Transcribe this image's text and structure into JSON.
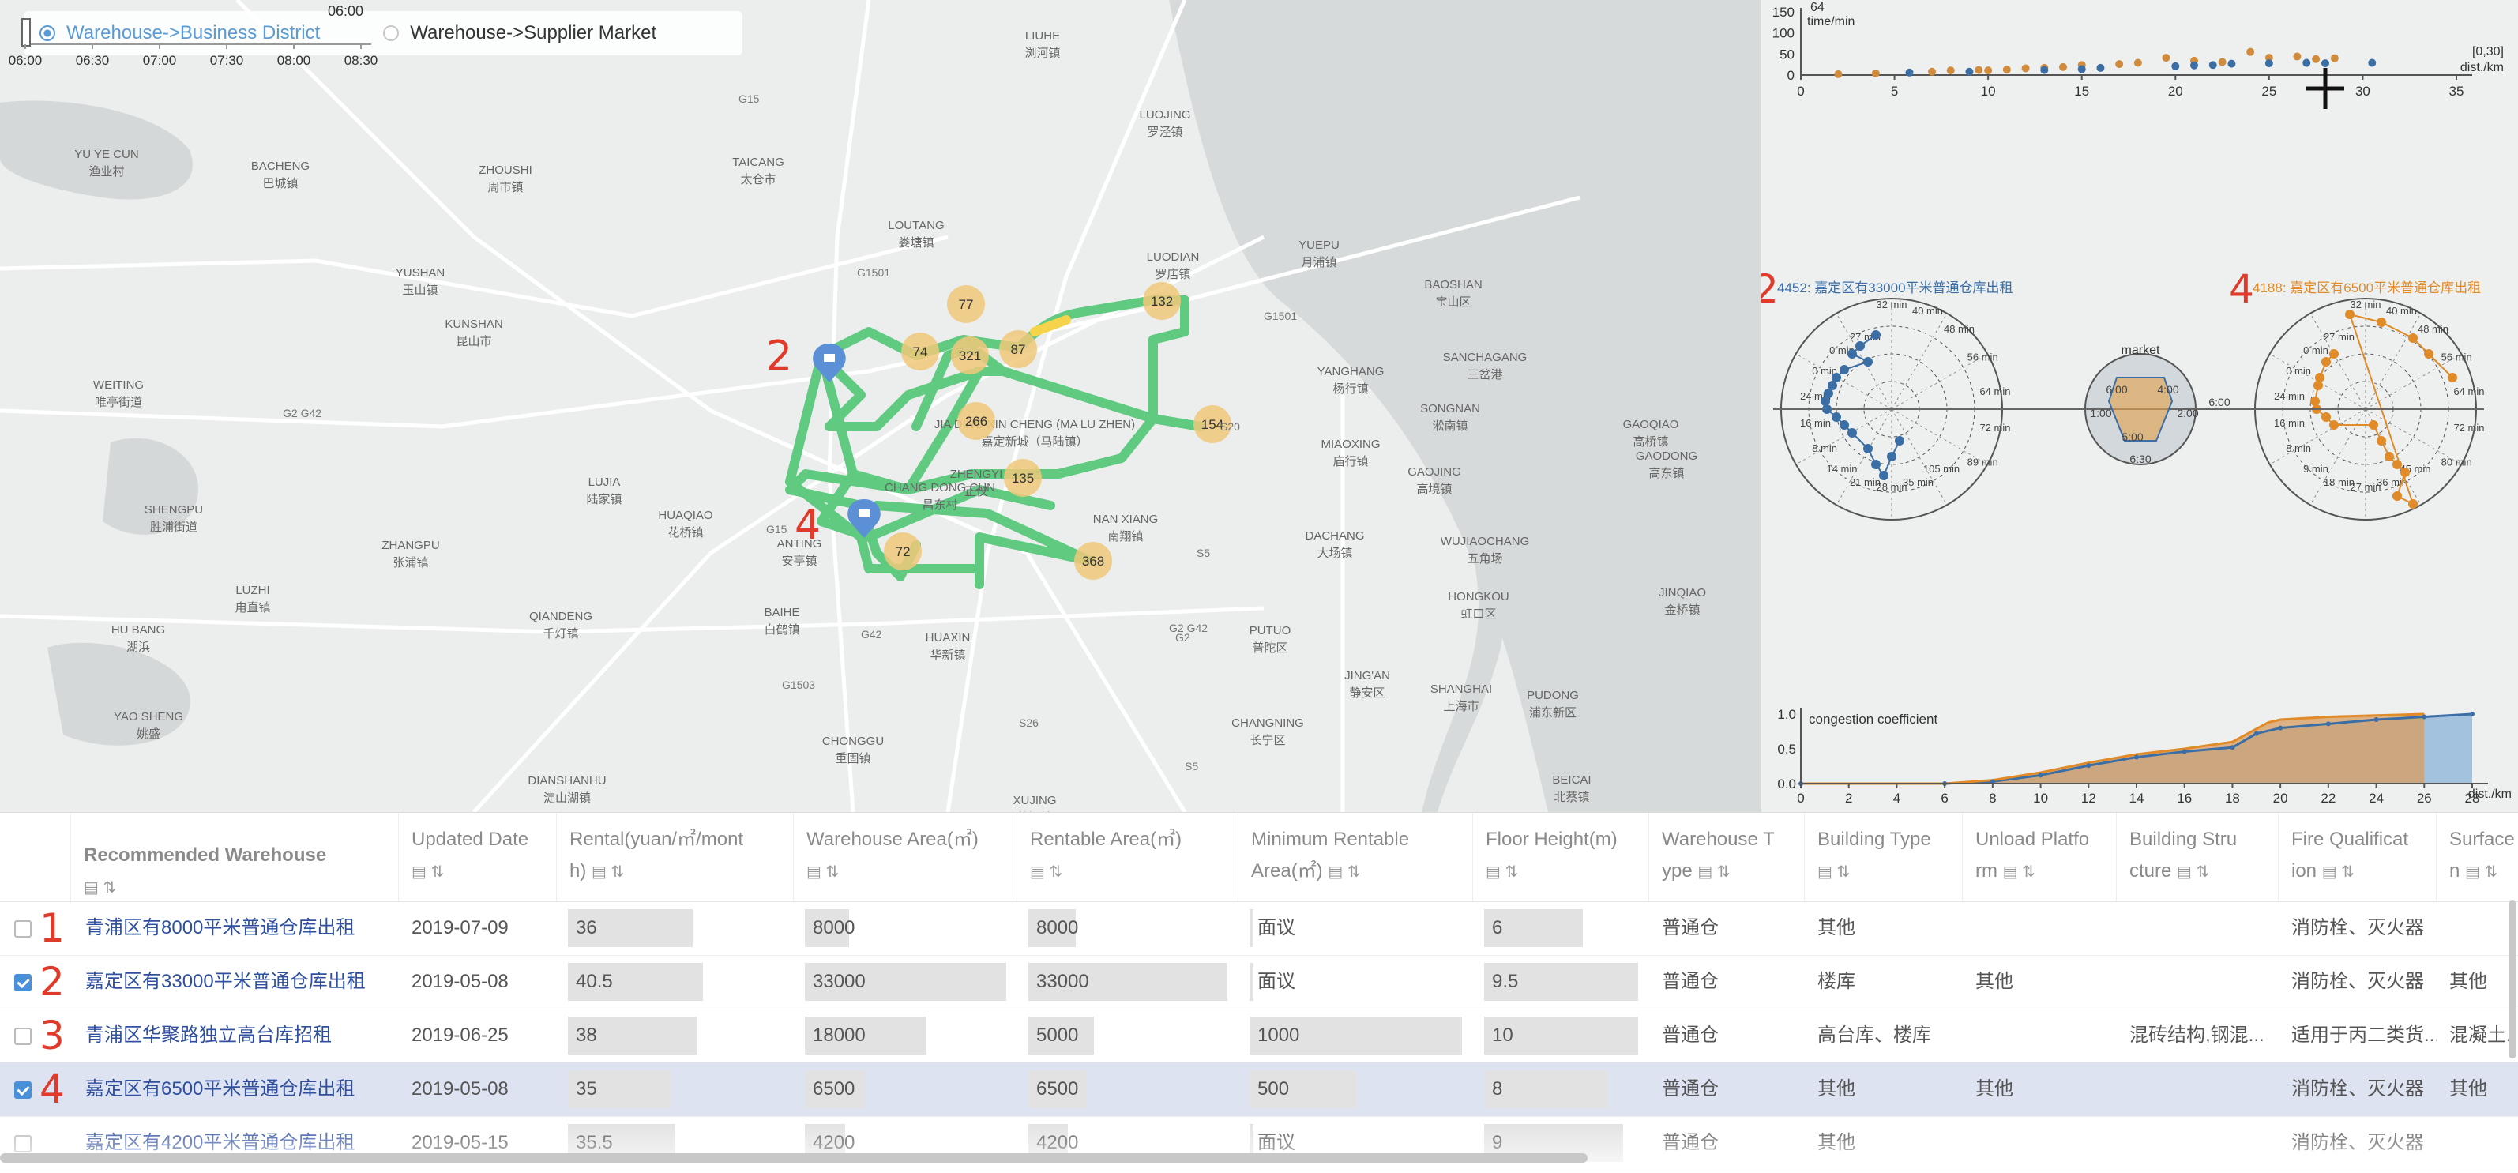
{
  "radio": {
    "opt1": "Warehouse->Business District",
    "opt2": "Warehouse->Supplier Market"
  },
  "map": {
    "places": [
      {
        "en": "LIUHE",
        "zh": "浏河镇"
      },
      {
        "en": "LUOJING",
        "zh": "罗泾镇"
      },
      {
        "en": "TAICANG",
        "zh": "太仓市"
      },
      {
        "en": "ZHOUSHI",
        "zh": "周市镇"
      },
      {
        "en": "BACHENG",
        "zh": "巴城镇"
      },
      {
        "en": "YU YE CUN",
        "zh": "渔业村"
      },
      {
        "en": "LOUTANG",
        "zh": "娄塘镇"
      },
      {
        "en": "LUODIAN",
        "zh": "罗店镇"
      },
      {
        "en": "YUEPU",
        "zh": "月浦镇"
      },
      {
        "en": "BAOSHAN",
        "zh": "宝山区"
      },
      {
        "en": "SANCHAGANG",
        "zh": "三岔港"
      },
      {
        "en": "YUSHAN",
        "zh": "玉山镇"
      },
      {
        "en": "KUNSHAN",
        "zh": "昆山市"
      },
      {
        "en": "WEITING",
        "zh": "唯亭街道"
      },
      {
        "en": "YANGHANG",
        "zh": "杨行镇"
      },
      {
        "en": "SONGNAN",
        "zh": "淞南镇"
      },
      {
        "en": "GAOQIAO",
        "zh": "高桥镇"
      },
      {
        "en": "GAODONG",
        "zh": "高东镇"
      },
      {
        "en": "MIAOXING",
        "zh": "庙行镇"
      },
      {
        "en": "GAOJING",
        "zh": "高境镇"
      },
      {
        "en": "SHENGPU",
        "zh": "胜浦街道"
      },
      {
        "en": "LUJIA",
        "zh": "陆家镇"
      },
      {
        "en": "HUAQIAO",
        "zh": "花桥镇"
      },
      {
        "en": "ZHANGPU",
        "zh": "张浦镇"
      },
      {
        "en": "NAN XIANG",
        "zh": "南翔镇"
      },
      {
        "en": "DACHANG",
        "zh": "大场镇"
      },
      {
        "en": "WUJIAOCHANG",
        "zh": "五角场"
      },
      {
        "en": "JINQIAO",
        "zh": "金桥镇"
      },
      {
        "en": "LUZHI",
        "zh": "甪直镇"
      },
      {
        "en": "QIANDENG",
        "zh": "千灯镇"
      },
      {
        "en": "BAIHE",
        "zh": "白鹤镇"
      },
      {
        "en": "HUAXIN",
        "zh": "华新镇"
      },
      {
        "en": "PUTUO",
        "zh": "普陀区"
      },
      {
        "en": "HONGKOU",
        "zh": "虹口区"
      },
      {
        "en": "HU BANG",
        "zh": "湖浜"
      },
      {
        "en": "CHONGGU",
        "zh": "重固镇"
      },
      {
        "en": "JING'AN",
        "zh": "静安区"
      },
      {
        "en": "SHANGHAI",
        "zh": "上海市"
      },
      {
        "en": "PUDONG",
        "zh": "浦东新区"
      },
      {
        "en": "CHANGNING",
        "zh": "长宁区"
      },
      {
        "en": "YAO SHENG",
        "zh": "姚盛"
      },
      {
        "en": "DIANSHANHU",
        "zh": "淀山湖镇"
      },
      {
        "en": "XUJING",
        "zh": "徐泾镇"
      },
      {
        "en": "BEICAI",
        "zh": "北蔡镇"
      },
      {
        "en": "JIA DING XIN CHENG (MA LU ZHEN)",
        "zh": "嘉定新城（马陆镇）"
      },
      {
        "en": "ZHENGYI",
        "zh": "正仪"
      },
      {
        "en": "CHANG DONG CUN",
        "zh": "昌东村"
      },
      {
        "en": "ANTING",
        "zh": "安亭镇"
      }
    ],
    "clusters": [
      "77",
      "132",
      "74",
      "321",
      "87",
      "266",
      "154",
      "135",
      "72",
      "368"
    ],
    "annotations": [
      "2",
      "4"
    ],
    "roads": [
      "G15",
      "G1501",
      "G15",
      "S20",
      "G2 G42",
      "G42",
      "G2",
      "S5",
      "G1503",
      "S26",
      "G2 G42",
      "S5",
      "G1501"
    ],
    "timeline": {
      "ticks": [
        "06:00",
        "06:30",
        "07:00",
        "07:30",
        "08:00",
        "08:30"
      ],
      "current": "06:00"
    }
  },
  "panel": {
    "scatter": {
      "ylabel": "time/min",
      "xlabel": "dist./km",
      "yticks": [
        "150",
        "100",
        "50",
        "0"
      ],
      "xticks": [
        "0",
        "5",
        "10",
        "15",
        "20",
        "25",
        "30",
        "35"
      ],
      "max_marker": "64",
      "range_label": "[0,30]",
      "points_blue": [
        [
          5.8,
          6
        ],
        [
          9,
          8
        ],
        [
          13,
          12
        ],
        [
          15,
          14
        ],
        [
          16,
          17
        ],
        [
          20,
          21
        ],
        [
          21,
          23
        ],
        [
          22,
          24
        ],
        [
          23,
          27
        ],
        [
          25,
          28
        ],
        [
          27,
          29
        ],
        [
          28,
          28
        ],
        [
          30.5,
          29
        ]
      ],
      "points_orange": [
        [
          2,
          2
        ],
        [
          4,
          4
        ],
        [
          7,
          8
        ],
        [
          8,
          11
        ],
        [
          9.5,
          12
        ],
        [
          10,
          11
        ],
        [
          11,
          13
        ],
        [
          12,
          16
        ],
        [
          13,
          17
        ],
        [
          14,
          19
        ],
        [
          15,
          24
        ],
        [
          17,
          26
        ],
        [
          18,
          29
        ],
        [
          19.5,
          41
        ],
        [
          21,
          34
        ],
        [
          22.5,
          31
        ],
        [
          24,
          55
        ],
        [
          25,
          41
        ],
        [
          26.5,
          44
        ],
        [
          27.5,
          38
        ],
        [
          28.5,
          40
        ]
      ]
    },
    "radial_left": {
      "annotation": "2",
      "title": "4452: 嘉定区有33000平米普通仓库出租",
      "color": "#3b6ea5",
      "labels": [
        "32 min",
        "40 min",
        "48 min",
        "56 min",
        "64 min",
        "72 min",
        "89 min",
        "105 min",
        "35 min",
        "28 min",
        "21 min",
        "14 min",
        "8 min",
        "16 min",
        "24 min",
        "0 min",
        "0 min",
        "27 min"
      ]
    },
    "radial_center": {
      "label": "market",
      "labels": [
        "6:00",
        "6:30",
        "1:00",
        "2:00",
        "4:00",
        "6:00",
        "5:00"
      ]
    },
    "radial_right": {
      "annotation": "4",
      "title": "4188: 嘉定区有6500平米普通仓库出租",
      "color": "#e08a28",
      "labels": [
        "32 min",
        "40 min",
        "48 min",
        "56 min",
        "64 min",
        "72 min",
        "80 min",
        "45 min",
        "36 min",
        "27 min",
        "18 min",
        "9 min",
        "8 min",
        "16 min",
        "24 min",
        "0 min",
        "0 min",
        "27 min"
      ]
    },
    "area": {
      "ylabel": "congestion coefficient",
      "xlabel": "dist./km",
      "yticks": [
        "1.0",
        "0.5",
        "0.0"
      ],
      "xticks": [
        "0",
        "2",
        "4",
        "6",
        "8",
        "10",
        "12",
        "14",
        "16",
        "18",
        "20",
        "22",
        "24",
        "26",
        "28"
      ],
      "end_label": "28",
      "series_blue": [
        [
          0,
          0
        ],
        [
          6,
          0
        ],
        [
          8,
          0.03
        ],
        [
          10,
          0.12
        ],
        [
          12,
          0.26
        ],
        [
          14,
          0.38
        ],
        [
          16,
          0.46
        ],
        [
          18,
          0.52
        ],
        [
          19,
          0.72
        ],
        [
          20,
          0.8
        ],
        [
          22,
          0.86
        ],
        [
          24,
          0.92
        ],
        [
          26,
          0.96
        ],
        [
          28,
          1.0
        ]
      ],
      "series_orange": [
        [
          0,
          0
        ],
        [
          6,
          0
        ],
        [
          8,
          0.05
        ],
        [
          10,
          0.16
        ],
        [
          12,
          0.3
        ],
        [
          14,
          0.42
        ],
        [
          16,
          0.5
        ],
        [
          18,
          0.6
        ],
        [
          19.5,
          0.88
        ],
        [
          20,
          0.92
        ],
        [
          22,
          0.96
        ],
        [
          24,
          0.98
        ],
        [
          26,
          1.0
        ]
      ]
    }
  },
  "table": {
    "headers": [
      {
        "l1": "Recommended Warehouse",
        "l2": ""
      },
      {
        "l1": "Updated Date",
        "l2": ""
      },
      {
        "l1": "Rental(yuan/㎡/mont",
        "l2": "h)"
      },
      {
        "l1": "Warehouse Area(㎡)",
        "l2": ""
      },
      {
        "l1": "Rentable Area(㎡)",
        "l2": ""
      },
      {
        "l1": "Minimum Rentable",
        "l2": "Area(㎡)"
      },
      {
        "l1": "Floor Height(m)",
        "l2": ""
      },
      {
        "l1": "Warehouse T",
        "l2": "ype"
      },
      {
        "l1": "Building Type",
        "l2": ""
      },
      {
        "l1": "Unload Platfo",
        "l2": "rm"
      },
      {
        "l1": "Building Stru",
        "l2": "cture"
      },
      {
        "l1": "Fire Qualificat",
        "l2": "ion"
      },
      {
        "l1": "Surface",
        "l2": "n"
      }
    ],
    "rows": [
      {
        "num": "1",
        "checked": false,
        "sel": false,
        "name": "青浦区有8000平米普通仓库出租",
        "date": "2019-07-09",
        "rental": "36",
        "area": "8000",
        "rentable": "8000",
        "min": "面议",
        "height": "6",
        "wtype": "普通仓",
        "btype": "其他",
        "unload": "",
        "struct": "",
        "fire": "消防栓、灭火器",
        "surface": ""
      },
      {
        "num": "2",
        "checked": true,
        "sel": false,
        "name": "嘉定区有33000平米普通仓库出租",
        "date": "2019-05-08",
        "rental": "40.5",
        "area": "33000",
        "rentable": "33000",
        "min": "面议",
        "height": "9.5",
        "wtype": "普通仓",
        "btype": "楼库",
        "unload": "其他",
        "struct": "",
        "fire": "消防栓、灭火器",
        "surface": "其他"
      },
      {
        "num": "3",
        "checked": false,
        "sel": false,
        "name": "青浦区华聚路独立高台库招租",
        "date": "2019-06-25",
        "rental": "38",
        "area": "18000",
        "rentable": "5000",
        "min": "1000",
        "height": "10",
        "wtype": "普通仓",
        "btype": "高台库、楼库",
        "unload": "",
        "struct": "混砖结构,钢混...",
        "fire": "适用于丙二类货...",
        "surface": "混凝土..."
      },
      {
        "num": "4",
        "checked": true,
        "sel": true,
        "name": "嘉定区有6500平米普通仓库出租",
        "date": "2019-05-08",
        "rental": "35",
        "area": "6500",
        "rentable": "6500",
        "min": "500",
        "height": "8",
        "wtype": "普通仓",
        "btype": "其他",
        "unload": "其他",
        "struct": "",
        "fire": "消防栓、灭火器",
        "surface": "其他"
      },
      {
        "num": "",
        "checked": false,
        "sel": false,
        "name": "嘉定区有4200平米普通仓库出租",
        "date": "2019-05-15",
        "rental": "35.5",
        "area": "4200",
        "rentable": "4200",
        "min": "面议",
        "height": "9",
        "wtype": "普通仓",
        "btype": "其他",
        "unload": "",
        "struct": "",
        "fire": "消防栓、灭火器",
        "surface": ""
      }
    ],
    "bar_fractions": {
      "rental": [
        0.58,
        0.63,
        0.6,
        0.48,
        0.5
      ],
      "area": [
        0.22,
        1.0,
        0.6,
        0.3,
        0.2
      ],
      "rentable": [
        0.24,
        1.0,
        0.33,
        0.29,
        0.2
      ],
      "min": [
        0.02,
        0.02,
        1.0,
        0.5,
        0.02
      ],
      "height": [
        0.64,
        1.0,
        1.0,
        0.8,
        0.9
      ]
    }
  }
}
